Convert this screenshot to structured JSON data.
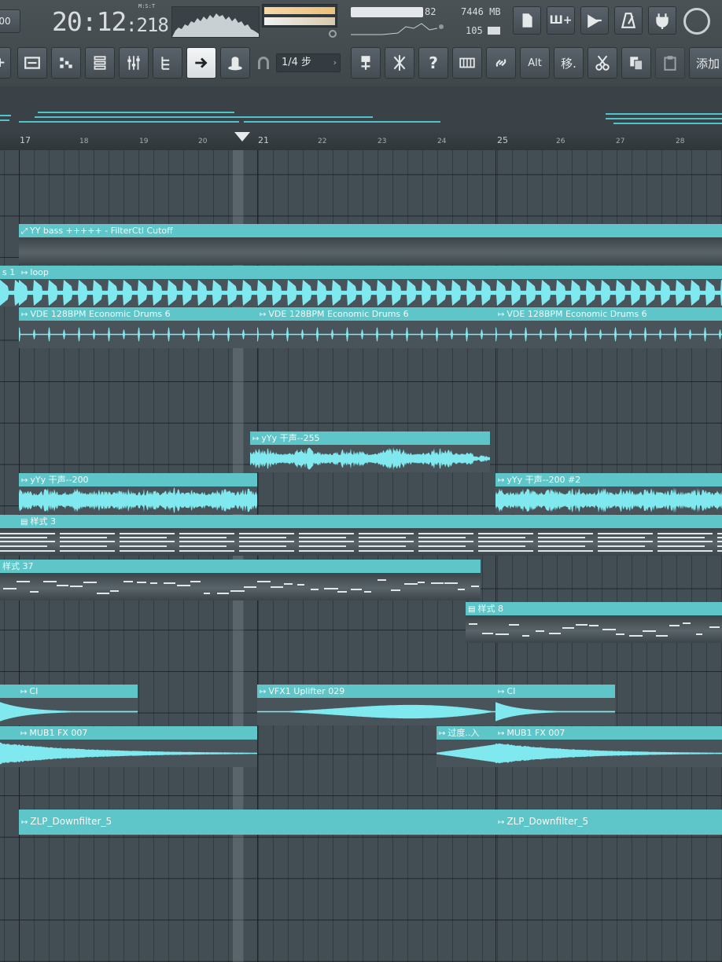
{
  "transport": {
    "tempo_fragment": "00",
    "time_main": "20:12",
    "time_sub": ":218",
    "time_label": "M:S:T",
    "volume_value": "82",
    "memory": "7446 MB",
    "polyphony": "105"
  },
  "toolbar": {
    "snap_value": "1/4 步",
    "help_label": "?",
    "alt_label": "Alt",
    "move_label": "移.",
    "add_label": "添加"
  },
  "ruler": {
    "bars": [
      "17",
      "18",
      "19",
      "20",
      "21",
      "22",
      "23",
      "24",
      "25",
      "26",
      "27",
      "28"
    ]
  },
  "clips": [
    {
      "name": "YY bass +++++ - FilterCtl Cutoff",
      "kind": "automation"
    },
    {
      "name": "s 1",
      "kind": "audio"
    },
    {
      "name": "loop",
      "kind": "audio"
    },
    {
      "name": "VDE 128BPM Economic Drums 6",
      "kind": "audio"
    },
    {
      "name": "VDE 128BPM Economic Drums 6",
      "kind": "audio"
    },
    {
      "name": "VDE 128BPM Economic Drums 6",
      "kind": "audio"
    },
    {
      "name": "yYy 干声--255",
      "kind": "audio"
    },
    {
      "name": "yYy 干声--200",
      "kind": "audio"
    },
    {
      "name": "yYy 干声--200 #2",
      "kind": "audio"
    },
    {
      "name": "样式 3",
      "kind": "pattern"
    },
    {
      "name": "样式 37",
      "kind": "pattern"
    },
    {
      "name": "样式 8",
      "kind": "pattern"
    },
    {
      "name": "CI",
      "kind": "audio"
    },
    {
      "name": "VFX1 Uplifter 029",
      "kind": "audio"
    },
    {
      "name": "CI",
      "kind": "audio"
    },
    {
      "name": "MUB1 FX 007",
      "kind": "audio"
    },
    {
      "name": "过度..入",
      "kind": "audio"
    },
    {
      "name": "MUB1 FX 007",
      "kind": "audio"
    },
    {
      "name": "ZLP_Downfilter_5",
      "kind": "audio"
    },
    {
      "name": "ZLP_Downfilter_5",
      "kind": "audio"
    }
  ],
  "colors": {
    "clip_header": "#5ec6c9",
    "waveform": "#7fe9ef",
    "grid": "#434d54"
  }
}
